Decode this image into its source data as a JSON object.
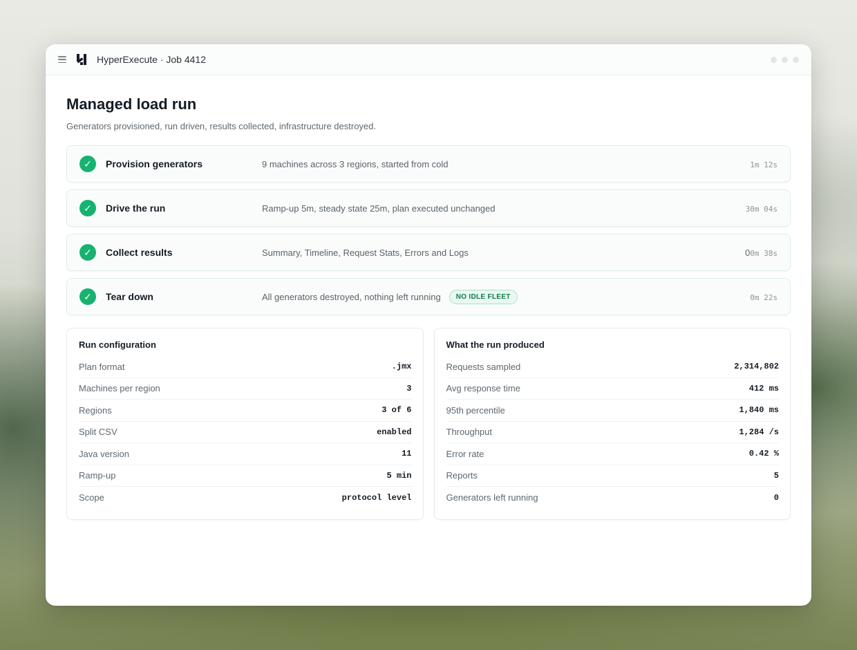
{
  "window": {
    "title": "HyperExecute · Job 4412"
  },
  "header": {
    "title": "Managed load run",
    "subtitle": "Generators provisioned, run driven, results collected, infrastructure destroyed."
  },
  "steps": [
    {
      "name": "Provision generators",
      "description": "9 machines across 3 regions, started from cold",
      "time_lead": "",
      "time": "1m 12s",
      "status": "complete"
    },
    {
      "name": "Drive the run",
      "description": "Ramp-up 5m, steady state 25m, plan executed unchanged",
      "time_lead": "",
      "time": "30m 04s",
      "status": "complete"
    },
    {
      "name": "Collect results",
      "description": "Summary, Timeline, Request Stats, Errors and Logs",
      "time_lead": "0",
      "time": "0m 38s",
      "status": "complete"
    },
    {
      "name": "Tear down",
      "description": "All generators destroyed, nothing left running",
      "badge": "NO IDLE FLEET",
      "time_lead": "",
      "time": "0m 22s",
      "status": "complete"
    }
  ],
  "config": {
    "title": "Run configuration",
    "rows": [
      {
        "label": "Plan format",
        "value": ".jmx"
      },
      {
        "label": "Machines per region",
        "value": "3"
      },
      {
        "label": "Regions",
        "value": "3 of 6"
      },
      {
        "label": "Split CSV",
        "value": "enabled"
      },
      {
        "label": "Java version",
        "value": "11"
      },
      {
        "label": "Ramp-up",
        "value": "5 min"
      },
      {
        "label": "Scope",
        "value": "protocol level"
      }
    ]
  },
  "results": {
    "title": "What the run produced",
    "rows": [
      {
        "label": "Requests sampled",
        "value": "2,314,802"
      },
      {
        "label": "Avg response time",
        "value": "412 ms"
      },
      {
        "label": "95th percentile",
        "value": "1,840 ms"
      },
      {
        "label": "Throughput",
        "value": "1,284 /s"
      },
      {
        "label": "Error rate",
        "value": "0.42 %"
      },
      {
        "label": "Reports",
        "value": "5"
      },
      {
        "label": "Generators left running",
        "value": "0"
      }
    ]
  },
  "colors": {
    "success": "#17b26f",
    "badge_text": "#0f7a4d",
    "badge_bg": "#e9f8f0"
  },
  "icons": {
    "menu": "menu-icon",
    "logo": "app-logo-icon",
    "check": "check-circle-icon"
  }
}
